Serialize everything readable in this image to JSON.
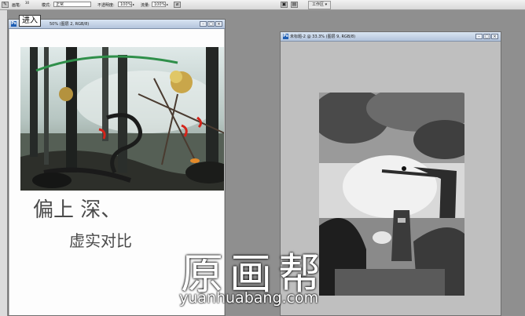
{
  "options_bar": {
    "brush_label": "画笔:",
    "brush_size": "30",
    "mode_label": "模式:",
    "mode_value": "正常",
    "opacity_label": "不透明度:",
    "opacity_value": "100%",
    "flow_label": "流量:",
    "flow_value": "100%",
    "workspace_label": "工作区 ▾"
  },
  "tooltip": {
    "text": "进入"
  },
  "left_window": {
    "title": "50% (图层 2, RGB/8)",
    "handwriting_line1": "偏上 深、",
    "handwriting_line2": "虚实对比"
  },
  "right_window": {
    "title": "未标题-2 @ 33.3% (图层 9, RGB/8)"
  },
  "watermark": {
    "big": "原画帮",
    "url": "yuanhuabang.com"
  },
  "colors": {
    "workspace_bg": "#8f8f8f",
    "titlebar": "#c6d3e6",
    "accent_red": "#d4241a"
  }
}
